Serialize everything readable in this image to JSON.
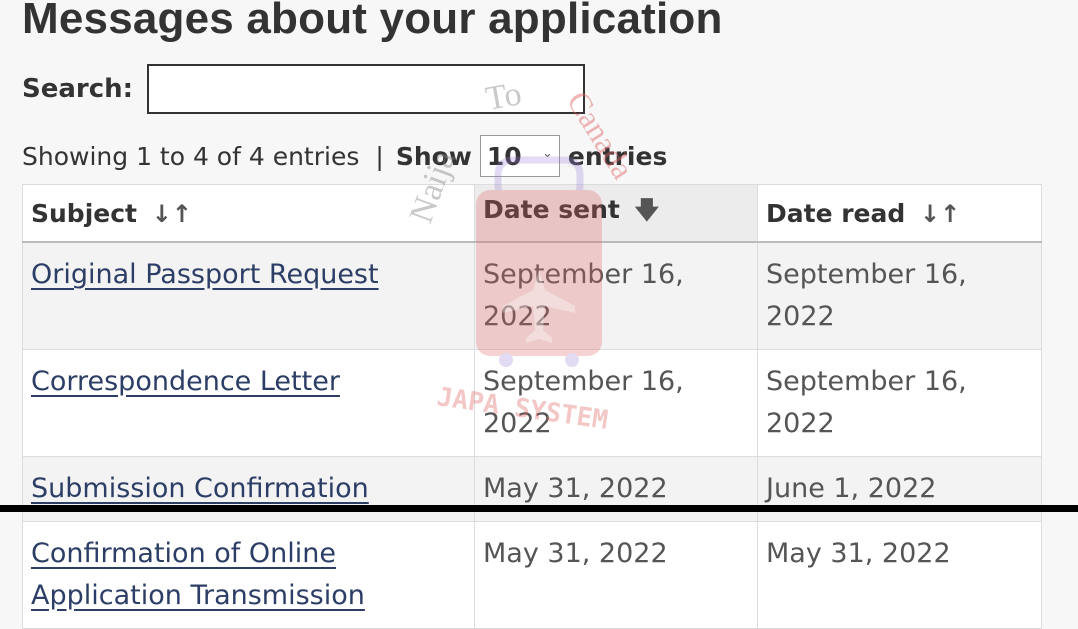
{
  "page": {
    "title": "Messages about your application"
  },
  "search": {
    "label": "Search:",
    "value": "",
    "placeholder": ""
  },
  "info": {
    "showing": "Showing 1 to 4 of 4 entries",
    "separator": "|",
    "show_label": "Show",
    "length_value": "10",
    "entries_label": "entries"
  },
  "table": {
    "headers": {
      "subject": "Subject",
      "date_sent": "Date sent",
      "date_read": "Date read"
    },
    "sort_icons": {
      "subject": "sort-both-icon",
      "date_sent": "sort-descending-icon",
      "date_read": "sort-both-icon"
    },
    "rows": [
      {
        "subject": "Original Passport Request",
        "date_sent": "September 16, 2022",
        "date_read": "September 16, 2022"
      },
      {
        "subject": "Correspondence Letter",
        "date_sent": "September 16, 2022",
        "date_read": "September 16, 2022"
      },
      {
        "subject": "Submission Confirmation",
        "date_sent": "May 31, 2022",
        "date_read": "June 1, 2022"
      },
      {
        "subject": "Confirmation of Online Application Transmission",
        "date_sent": "May 31, 2022",
        "date_read": "May 31, 2022"
      }
    ]
  },
  "watermark": {
    "arc_left": "Naija",
    "arc_mid": "To",
    "arc_right": "Canada",
    "bottom": "JAPA SYSTEM",
    "colors": {
      "red": "#e06060",
      "purple": "#9b7fd6",
      "grey": "#888888"
    }
  },
  "colors": {
    "link": "#2c3e66",
    "text": "#333333",
    "row_alt": "#f3f3f3",
    "sorted_header": "#ececec"
  }
}
